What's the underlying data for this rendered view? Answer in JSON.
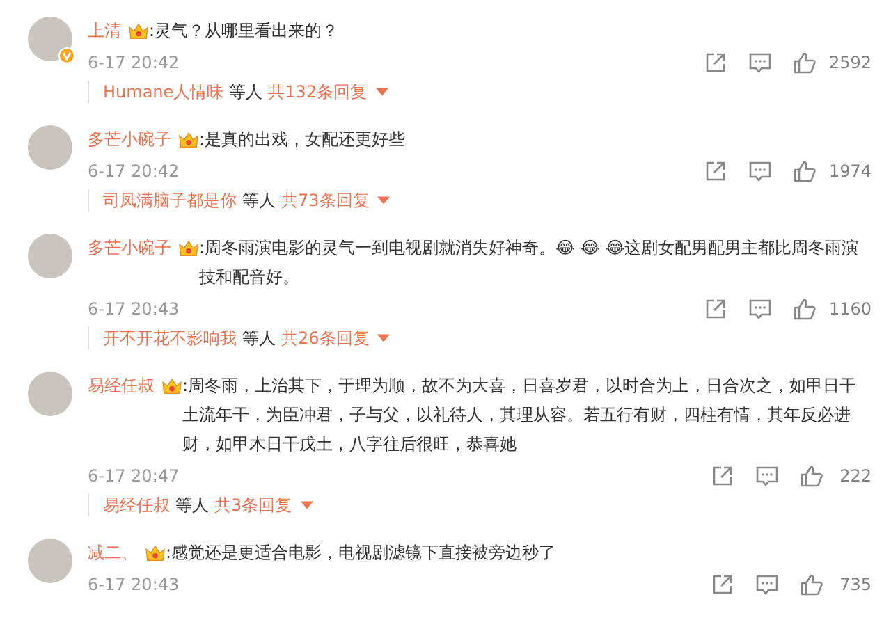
{
  "comments": [
    {
      "name": "上清",
      "verified": true,
      "text": ":灵气？从哪里看出来的？",
      "date": "6-17 20:42",
      "likes": "2592",
      "reply": {
        "name": "Humane人情味",
        "label": "等人",
        "count": "共132条回复"
      }
    },
    {
      "name": "多芒小碗子",
      "verified": false,
      "text": ":是真的出戏，女配还更好些",
      "date": "6-17 20:42",
      "likes": "1974",
      "reply": {
        "name": "司凤满脑子都是你",
        "label": "等人",
        "count": "共73条回复"
      }
    },
    {
      "name": "多芒小碗子",
      "verified": false,
      "text": ":周冬雨演电影的灵气一到电视剧就消失好神奇。😂 😂 😂这剧女配男配男主都比周冬雨演技和配音好。",
      "date": "6-17 20:43",
      "likes": "1160",
      "reply": {
        "name": "开不开花不影响我",
        "label": "等人",
        "count": "共26条回复"
      }
    },
    {
      "name": "易经任叔",
      "verified": false,
      "text": ":周冬雨，上治其下，于理为顺，故不为大喜，日喜岁君，以时合为上，日合次之，如甲日干土流年干，为臣冲君，子与父，以礼待人，其理从容。若五行有财，四柱有情，其年反必进财，如甲木日干戊土，八字往后很旺，恭喜她",
      "date": "6-17 20:47",
      "likes": "222",
      "reply": {
        "name": "易经任叔",
        "label": "等人",
        "count": "共3条回复"
      }
    },
    {
      "name": "减二、",
      "verified": false,
      "text": ":感觉还是更适合电影，电视剧滤镜下直接被旁边秒了",
      "date": "6-17 20:43",
      "likes": "735"
    }
  ]
}
